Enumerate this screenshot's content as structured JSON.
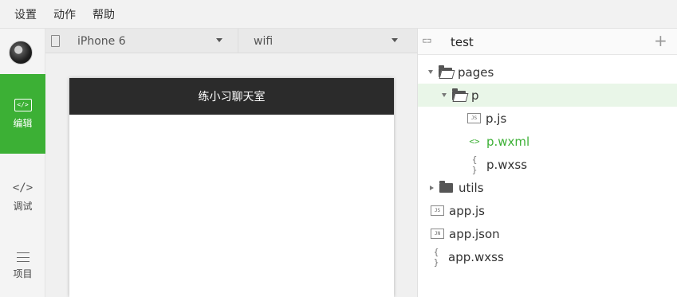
{
  "menubar": {
    "items": [
      "设置",
      "动作",
      "帮助"
    ]
  },
  "sidebar": {
    "items": [
      {
        "label": "编辑",
        "icon": "edit-icon",
        "active": true
      },
      {
        "label": "调试",
        "icon": "code-icon"
      },
      {
        "label": "项目",
        "icon": "menu-icon"
      }
    ],
    "accent": "#3cb035"
  },
  "simulator": {
    "device": "iPhone 6",
    "network": "wifi",
    "page_title": "练小习聊天室"
  },
  "explorer": {
    "project": "test",
    "add_label": "+",
    "tree": [
      {
        "name": "pages",
        "type": "folder",
        "expanded": true
      },
      {
        "name": "p",
        "type": "folder",
        "expanded": true,
        "selected": true
      },
      {
        "name": "p.js",
        "type": "file",
        "badge": "JS"
      },
      {
        "name": "p.wxml",
        "type": "file",
        "badge": "<>",
        "active": true
      },
      {
        "name": "p.wxss",
        "type": "file",
        "badge": "{ }"
      },
      {
        "name": "utils",
        "type": "folder",
        "expanded": false
      },
      {
        "name": "app.js",
        "type": "file",
        "badge": "JS"
      },
      {
        "name": "app.json",
        "type": "file",
        "badge": "JN"
      },
      {
        "name": "app.wxss",
        "type": "file",
        "badge": "{ }"
      }
    ]
  }
}
